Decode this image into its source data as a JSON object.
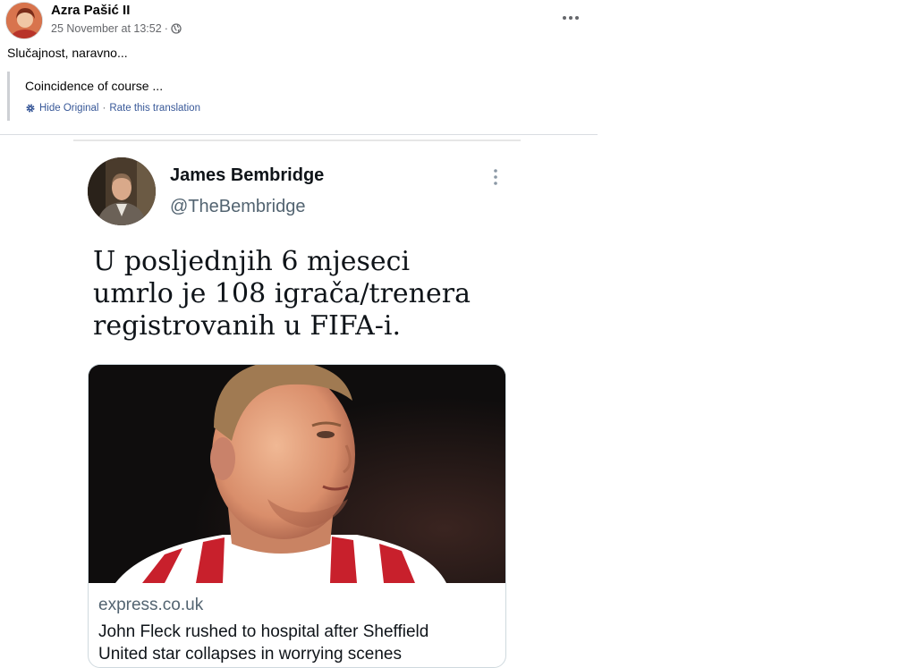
{
  "post": {
    "author": "Azra Pašić II",
    "timestamp": "25 November at 13:52",
    "meta_separator": "·",
    "text": "Slučajnost, naravno...",
    "translation": {
      "text": "Coincidence of course ...",
      "hide_original": "Hide Original",
      "separator": "·",
      "rate_translation": "Rate this translation"
    },
    "icons": {
      "privacy": "globe-icon",
      "menu": "more-horizontal-icon",
      "translation": "gear-icon"
    }
  },
  "shared_tweet": {
    "display_name": "James Bembridge",
    "handle": "@TheBembridge",
    "text_lines": [
      "U posljednjih 6 mjeseci",
      "umrlo je 108 igrača/trenera",
      "registrovanih u FIFA-i."
    ],
    "card": {
      "domain": "express.co.uk",
      "title_lines": [
        "John Fleck rushed to hospital after Sheffield",
        "United star collapses in worrying scenes"
      ]
    }
  },
  "colors": {
    "secondary_text": "#65676b",
    "link": "#385898",
    "tweet_secondary": "#536471"
  }
}
